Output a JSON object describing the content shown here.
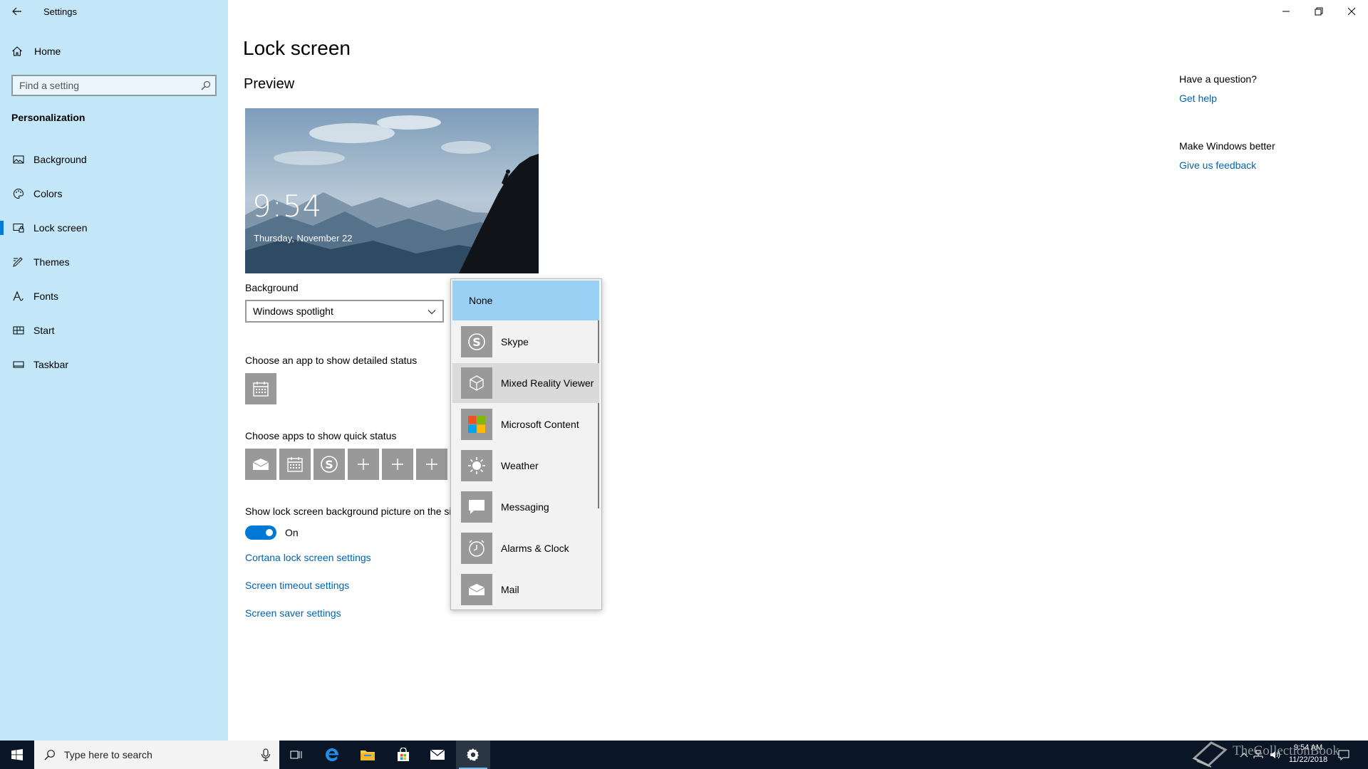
{
  "window": {
    "app_title": "Settings",
    "caption": {
      "minimize_icon": "minimize-icon",
      "maximize_icon": "restore-icon",
      "close_icon": "close-icon"
    }
  },
  "sidebar": {
    "home_label": "Home",
    "search_placeholder": "Find a setting",
    "section_heading": "Personalization",
    "items": [
      {
        "label": "Background",
        "icon": "picture-icon",
        "active": false
      },
      {
        "label": "Colors",
        "icon": "palette-icon",
        "active": false
      },
      {
        "label": "Lock screen",
        "icon": "lock-screen-icon",
        "active": true
      },
      {
        "label": "Themes",
        "icon": "brush-icon",
        "active": false
      },
      {
        "label": "Fonts",
        "icon": "font-icon",
        "active": false
      },
      {
        "label": "Start",
        "icon": "start-icon",
        "active": false
      },
      {
        "label": "Taskbar",
        "icon": "taskbar-icon",
        "active": false
      }
    ]
  },
  "main": {
    "page_title": "Lock screen",
    "preview_heading": "Preview",
    "preview": {
      "time": "9:54",
      "date": "Thursday, November 22"
    },
    "background_label": "Background",
    "background_value": "Windows spotlight",
    "detailed_status_label": "Choose an app to show detailed status",
    "quick_status_label": "Choose apps to show quick status",
    "signin_label": "Show lock screen background picture on the si",
    "toggle_state": "On",
    "links": {
      "cortana": "Cortana lock screen settings",
      "timeout": "Screen timeout settings",
      "saver": "Screen saver settings"
    }
  },
  "right": {
    "question_heading": "Have a question?",
    "get_help": "Get help",
    "better_heading": "Make Windows better",
    "feedback": "Give us feedback"
  },
  "flyout": {
    "options": [
      {
        "label": "None",
        "selected": true
      },
      {
        "label": "Skype",
        "icon": "skype-icon"
      },
      {
        "label": "Mixed Reality Viewer",
        "icon": "cube-icon",
        "hover": true
      },
      {
        "label": "Microsoft Content",
        "icon": "microsoft-logo-icon"
      },
      {
        "label": "Weather",
        "icon": "sun-icon"
      },
      {
        "label": "Messaging",
        "icon": "chat-icon"
      },
      {
        "label": "Alarms & Clock",
        "icon": "clock-icon"
      },
      {
        "label": "Mail",
        "icon": "mail-icon"
      }
    ]
  },
  "taskbar": {
    "search_placeholder": "Type here to search",
    "clock_time": "9:54 AM",
    "clock_date": "11/22/2018",
    "watermark": "TheCollectionBook"
  },
  "colors": {
    "sidebar_bg": "#c3e7f9",
    "accent": "#0078d7",
    "link": "#0063b1",
    "tile_gray": "#999999",
    "taskbar_bg": "#0a1626"
  }
}
